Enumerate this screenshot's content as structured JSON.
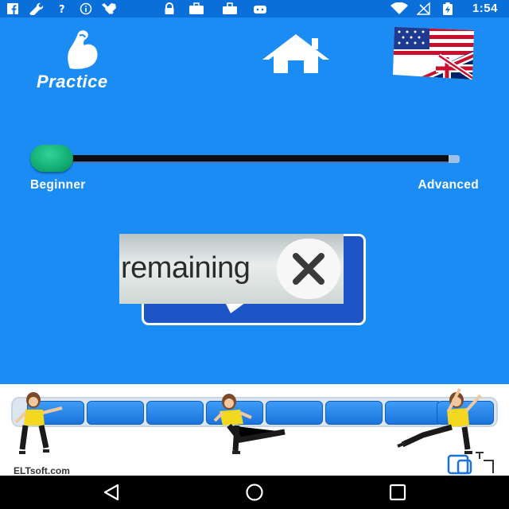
{
  "status_bar": {
    "time": "1:54",
    "icons": [
      "facebook-icon",
      "wrench-icon",
      "help-icon",
      "info-icon",
      "tools-icon",
      "lock-icon",
      "briefcase-icon",
      "bag-icon",
      "android-icon",
      "wifi-icon",
      "signal-icon",
      "battery-charging-icon"
    ]
  },
  "header": {
    "practice_label": "Practice",
    "home_icon": "home-icon",
    "flag_icon": "us-uk-flag-icon"
  },
  "level_slider": {
    "min_label": "Beginner",
    "max_label": "Advanced",
    "value": 0
  },
  "ad_overlay": {
    "text": "remaining"
  },
  "progress": {
    "cell_count": 8
  },
  "footer": {
    "brand": "ELTsoft.com"
  },
  "colors": {
    "background": "#1a8cf3",
    "bubble": "#1e55c6",
    "thumb": "#0ea66d",
    "status_bar": "#0a6fd8"
  }
}
